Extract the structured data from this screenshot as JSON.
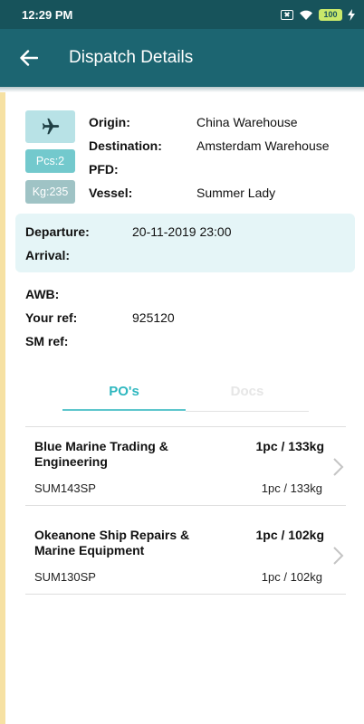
{
  "status_bar": {
    "time": "12:29 PM",
    "battery": "100"
  },
  "app_bar": {
    "title": "Dispatch Details"
  },
  "shipment": {
    "mode_icon": "airplane-icon",
    "pcs": "Pcs:2",
    "kg": "Kg:235",
    "fields": [
      {
        "label": "Origin:",
        "value": "China Warehouse"
      },
      {
        "label": "Destination:",
        "value": "Amsterdam Warehouse"
      },
      {
        "label": "PFD:",
        "value": ""
      },
      {
        "label": "Vessel:",
        "value": "Summer Lady"
      }
    ]
  },
  "times": [
    {
      "label": "Departure:",
      "value": "20-11-2019 23:00"
    },
    {
      "label": "Arrival:",
      "value": ""
    }
  ],
  "refs": [
    {
      "label": "AWB:",
      "value": ""
    },
    {
      "label": "Your ref:",
      "value": "925120"
    },
    {
      "label": "SM ref:",
      "value": ""
    }
  ],
  "tabs": [
    {
      "label": "PO's",
      "active": true
    },
    {
      "label": "Docs",
      "active": false
    }
  ],
  "pos": [
    {
      "name": "Blue Marine Trading & Engineering",
      "qty_bold": "1pc / 133kg",
      "code": "SUM143SP",
      "qty": "1pc / 133kg"
    },
    {
      "name": "Okeanone Ship Repairs & Marine Equipment",
      "qty_bold": "1pc / 102kg",
      "code": "SUM130SP",
      "qty": "1pc / 102kg"
    }
  ],
  "colors": {
    "status_bar": "#17535b",
    "app_bar": "#1c6571",
    "accent": "#2eb7bf",
    "panel": "#e5f5f7",
    "stripe": "#f6e1a3"
  }
}
